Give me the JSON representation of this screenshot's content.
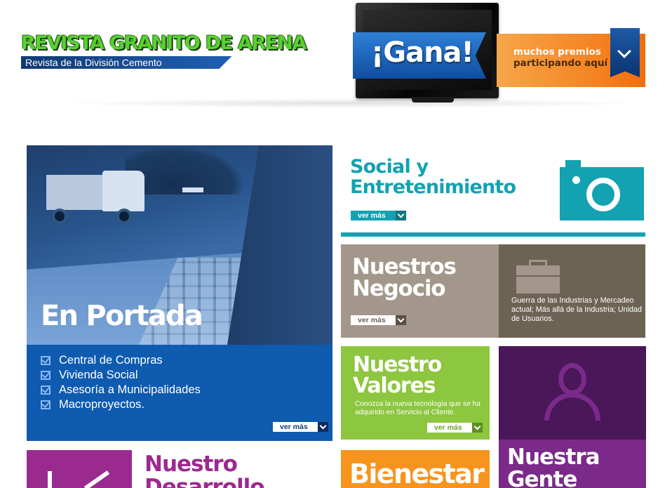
{
  "header": {
    "site_title": "REVISTA GRANITO DE ARENA",
    "site_subtitle": "Revista de la División Cemento"
  },
  "promo": {
    "badge": "¡Gana!",
    "line1": "muchos premios",
    "line2": "participando aquí",
    "icon": "chevron-down-icon"
  },
  "tiles": {
    "portada": {
      "title": "En Portada",
      "items": [
        "Central de Compras",
        "Vivienda Social",
        "Asesoría a Municipalidades",
        "Macroproyectos."
      ],
      "more": "ver más"
    },
    "social": {
      "title_line1": "Social y",
      "title_line2": "Entretenimiento",
      "more": "ver más",
      "icon": "camera-icon"
    },
    "negocio": {
      "title_line1": "Nuestros",
      "title_line2": "Negocio",
      "more": "ver más",
      "description": "Guerra de las Industrias y  Mercadeo actual; Más allá de la Industria; Unidad de Usuarios.",
      "icon": "briefcase-icon"
    },
    "valores": {
      "title_line1": "Nuestro",
      "title_line2": "Valores",
      "description": "Conozca la nueva tecnología que se ha adquirido en Servicio al Cliente.",
      "more": "ver más"
    },
    "gente": {
      "title_line1": "Nuestra",
      "title_line2": "Gente",
      "icon": "user-icon"
    },
    "bienestar": {
      "title": "Bienestar"
    },
    "desarrollo": {
      "title_line1": "Nuestro",
      "title_line2": "Desarrollo",
      "icon": "growth-chart-icon"
    }
  },
  "colors": {
    "portada": "#0e5bb0",
    "social": "#12a2b1",
    "negocio_light": "#a2978a",
    "negocio_dark": "#6d6355",
    "valores": "#8dc63f",
    "gente": "#4a1759",
    "bienestar": "#f7941d",
    "desarrollo": "#9b2a8f",
    "promo_orange": "#f48120"
  }
}
